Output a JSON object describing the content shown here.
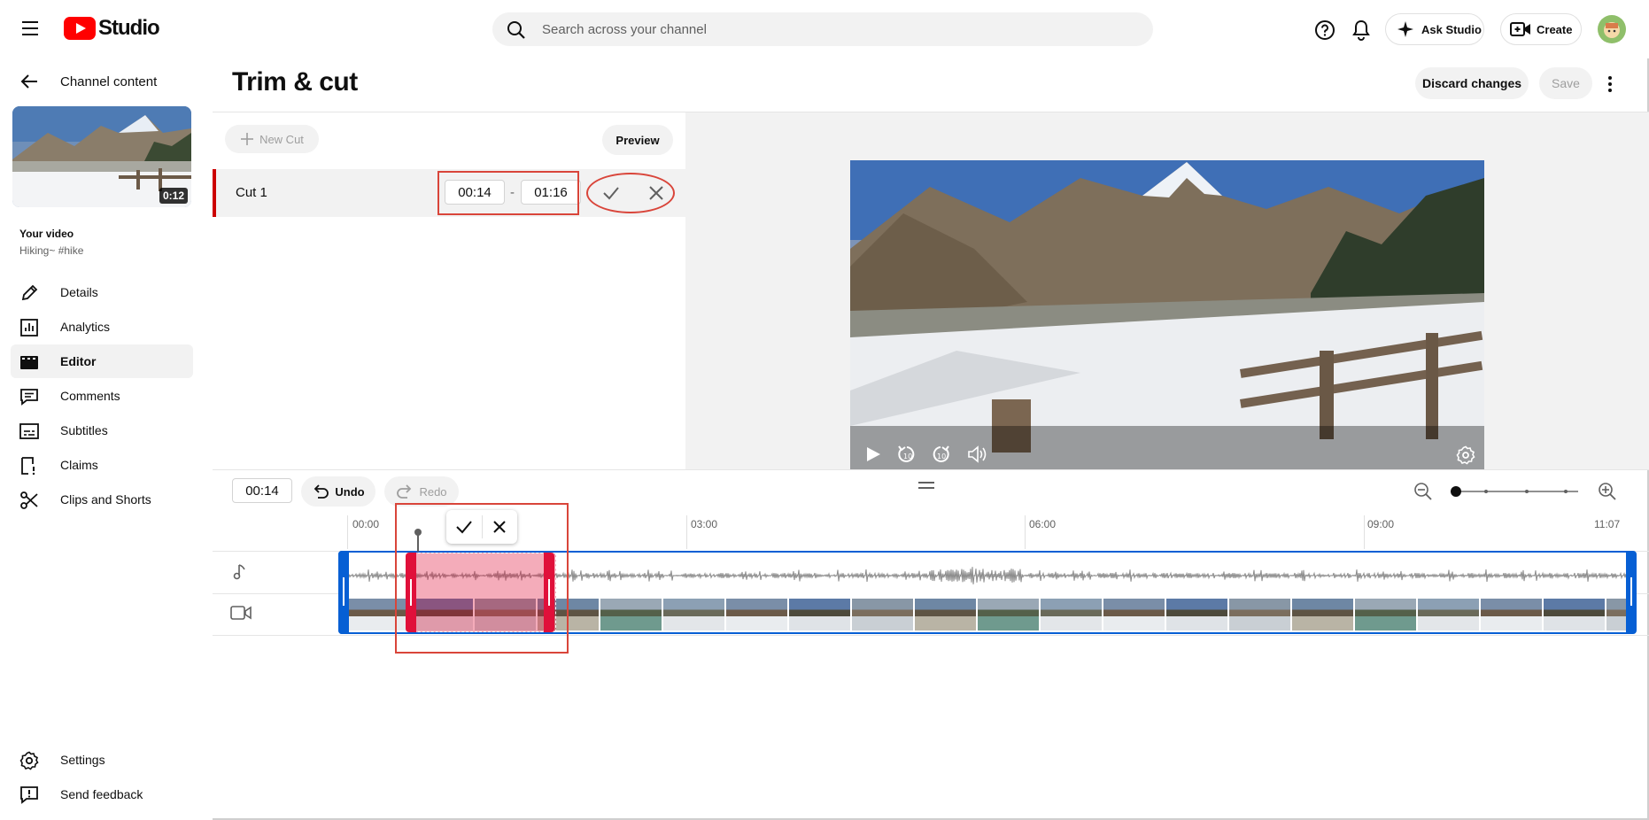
{
  "app": {
    "brand": "Studio",
    "search_placeholder": "Search across your channel",
    "ask_studio": "Ask Studio",
    "create": "Create"
  },
  "sidebar": {
    "back_label": "Channel content",
    "video_duration": "0:12",
    "your_video_label": "Your video",
    "video_title": "Hiking~ #hike",
    "items": [
      {
        "label": "Details",
        "icon": "pencil-icon"
      },
      {
        "label": "Analytics",
        "icon": "analytics-icon"
      },
      {
        "label": "Editor",
        "icon": "editor-icon",
        "active": true
      },
      {
        "label": "Comments",
        "icon": "comments-icon"
      },
      {
        "label": "Subtitles",
        "icon": "subtitles-icon"
      },
      {
        "label": "Claims",
        "icon": "claims-icon"
      },
      {
        "label": "Clips and Shorts",
        "icon": "scissors-icon"
      }
    ],
    "bottom_items": [
      {
        "label": "Settings",
        "icon": "gear-icon"
      },
      {
        "label": "Send feedback",
        "icon": "feedback-icon"
      }
    ]
  },
  "page": {
    "title": "Trim & cut",
    "discard_label": "Discard changes",
    "save_label": "Save"
  },
  "cuts": {
    "new_cut_label": "New Cut",
    "preview_label": "Preview",
    "items": [
      {
        "name": "Cut 1",
        "start": "00:14",
        "separator": "-",
        "end": "01:16"
      }
    ]
  },
  "timeline": {
    "current_time": "00:14",
    "undo_label": "Undo",
    "redo_label": "Redo",
    "ruler": [
      "00:00",
      "03:00",
      "06:00",
      "09:00",
      "11:07"
    ]
  },
  "colors": {
    "brand_red": "#ff0000",
    "cut_red": "#e0103a",
    "annotation_red": "#d9453a",
    "timeline_blue": "#065fd4"
  }
}
